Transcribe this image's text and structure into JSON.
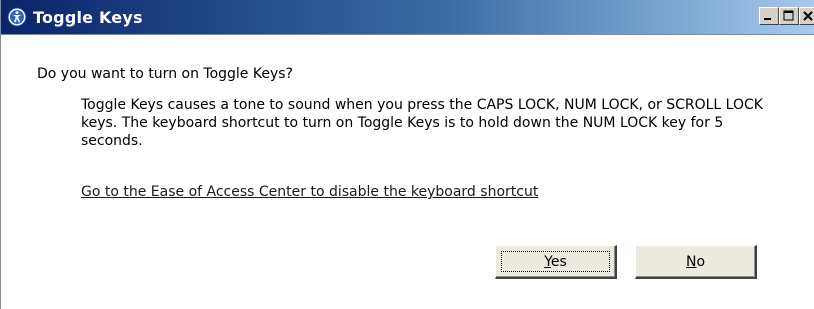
{
  "window": {
    "title": "Toggle Keys",
    "title_icon": "ease-of-access-icon",
    "controls": [
      "minimize",
      "maximize",
      "close"
    ]
  },
  "dialog": {
    "question": "Do you want to turn on Toggle Keys?",
    "description": "Toggle Keys causes a tone to sound when you press the CAPS LOCK, NUM LOCK, or SCROLL LOCK keys.  The keyboard shortcut to turn on Toggle Keys is to hold down the NUM LOCK key for 5 seconds.",
    "link": "Go to the Ease of Access Center to disable the keyboard shortcut",
    "buttons": {
      "yes": {
        "mnemonic": "Y",
        "rest": "es"
      },
      "no": {
        "mnemonic": "N",
        "rest": "o"
      }
    }
  },
  "colors": {
    "titlebar_start": "#0a246a",
    "titlebar_end": "#a6caf0",
    "button_face": "#ece9e1"
  }
}
